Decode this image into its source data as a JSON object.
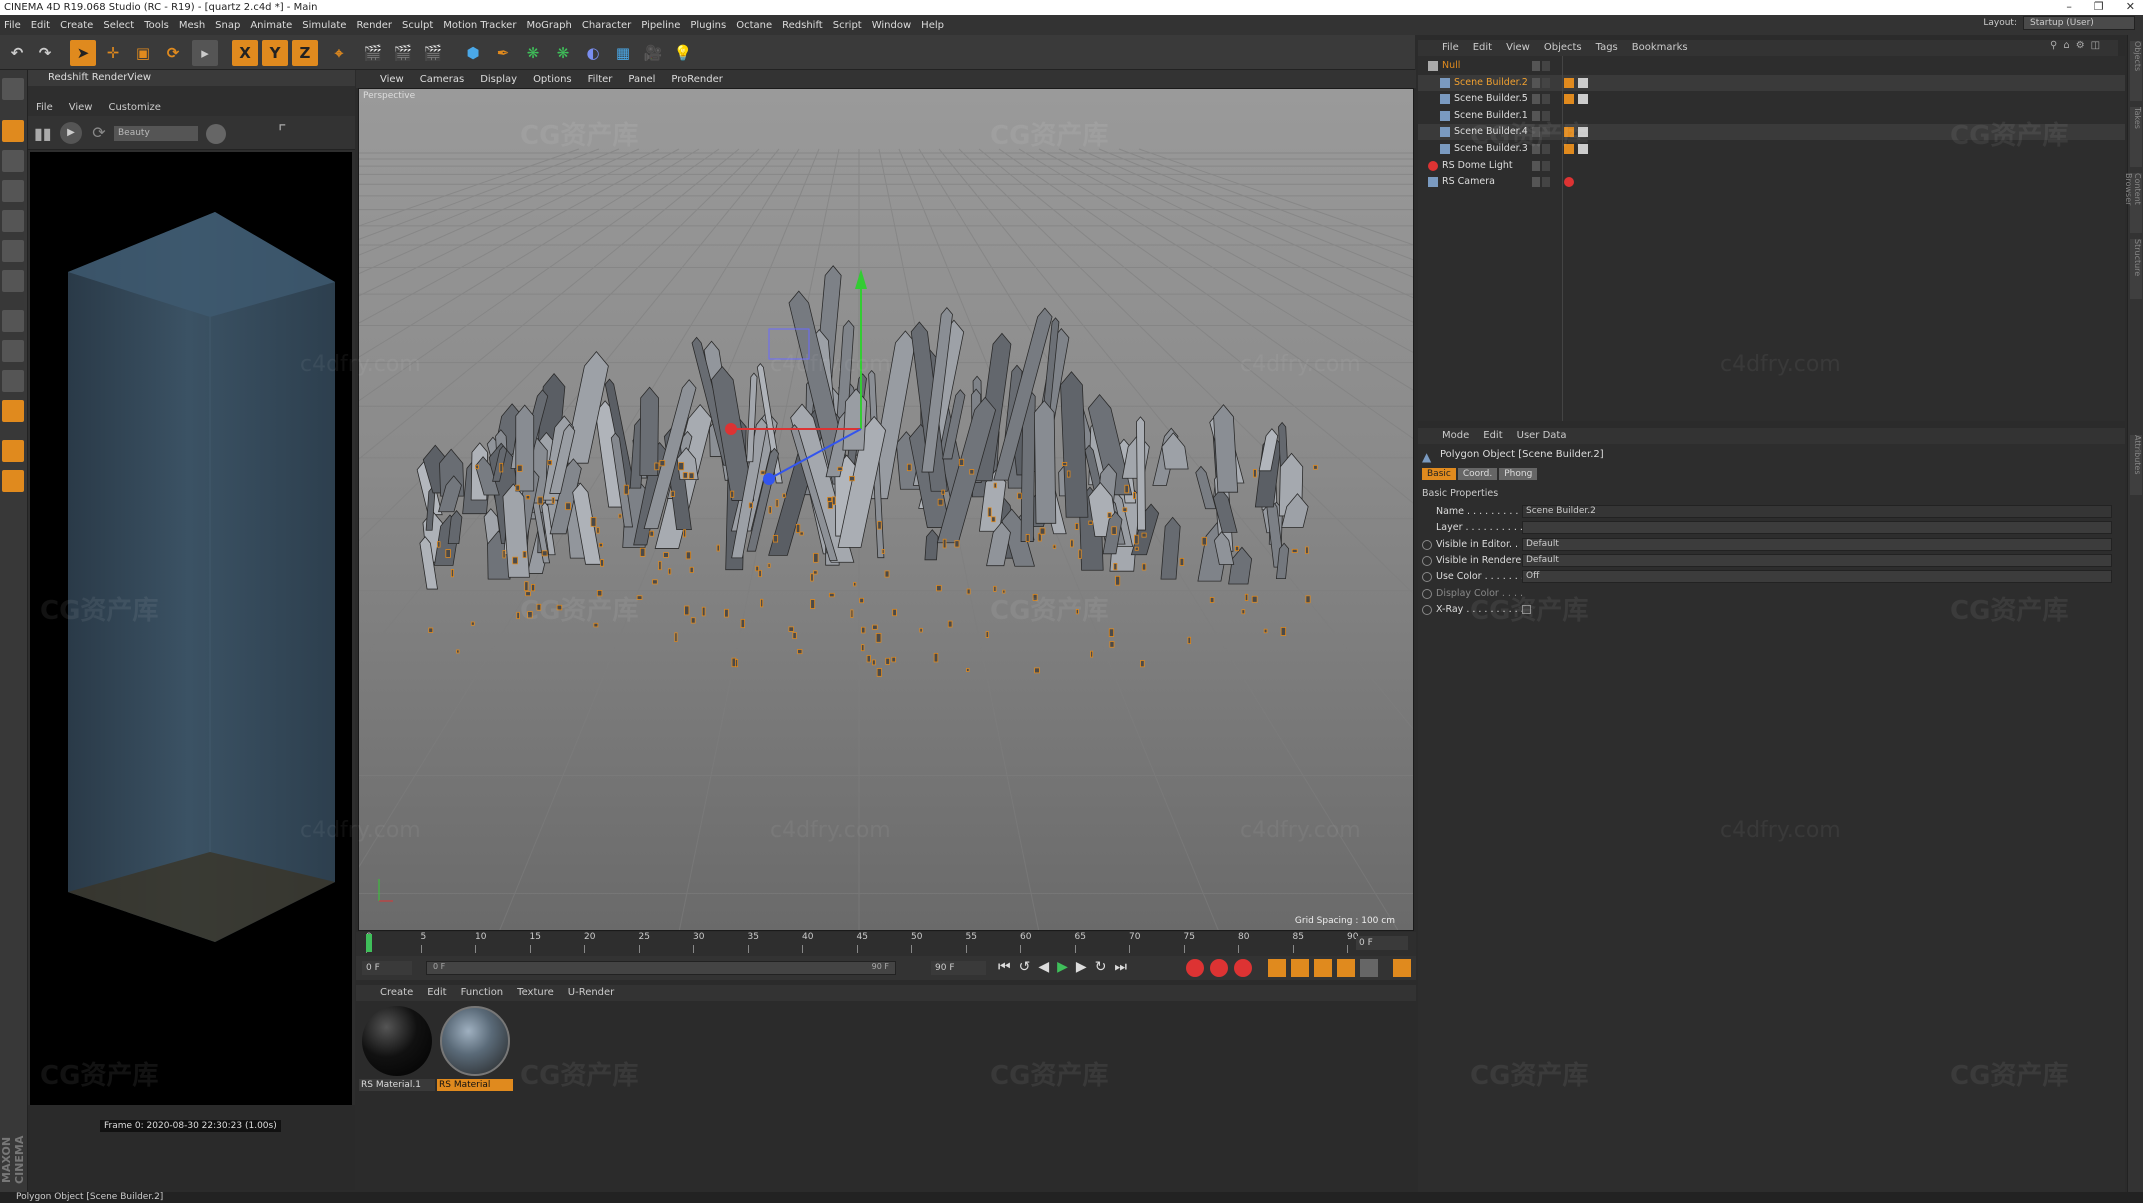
{
  "window": {
    "title": "CINEMA 4D R19.068 Studio (RC - R19) - [quartz 2.c4d *] - Main"
  },
  "menu": [
    "File",
    "Edit",
    "Create",
    "Select",
    "Tools",
    "Mesh",
    "Snap",
    "Animate",
    "Simulate",
    "Render",
    "Sculpt",
    "Motion Tracker",
    "MoGraph",
    "Character",
    "Pipeline",
    "Plugins",
    "Octane",
    "Redshift",
    "Script",
    "Window",
    "Help"
  ],
  "layout": {
    "label": "Layout:",
    "value": "Startup (User)"
  },
  "toolbar": {
    "axis_x": "X",
    "axis_y": "Y",
    "axis_z": "Z"
  },
  "renderview": {
    "title": "Redshift RenderView",
    "menu": [
      "File",
      "View",
      "Customize"
    ],
    "aov": "Beauty",
    "frame_info": "Frame 0:  2020-08-30  22:30:23  (1.00s)"
  },
  "viewport": {
    "menu": [
      "View",
      "Cameras",
      "Display",
      "Options",
      "Filter",
      "Panel",
      "ProRender"
    ],
    "label": "Perspective",
    "grid_spacing": "Grid Spacing : 100 cm"
  },
  "timeline": {
    "ticks": [
      "0",
      "5",
      "10",
      "15",
      "20",
      "25",
      "30",
      "35",
      "40",
      "45",
      "50",
      "55",
      "60",
      "65",
      "70",
      "75",
      "80",
      "85",
      "90"
    ],
    "current": "0 F",
    "start": "0 F",
    "range_start": "0 F",
    "range_end": "90 F",
    "end": "90 F"
  },
  "materials": {
    "menu": [
      "Create",
      "Edit",
      "Function",
      "Texture",
      "U-Render"
    ],
    "items": [
      {
        "name": "RS Material.1",
        "selected": false
      },
      {
        "name": "RS Material",
        "selected": true
      }
    ]
  },
  "objects": {
    "menu": [
      "File",
      "Edit",
      "View",
      "Objects",
      "Tags",
      "Bookmarks"
    ],
    "rows": [
      {
        "name": "Null",
        "color": "#e08a1e",
        "indent": 0
      },
      {
        "name": "Scene Builder.2",
        "color": "#f0a030",
        "indent": 1
      },
      {
        "name": "Scene Builder.5",
        "color": "#dddddd",
        "indent": 1
      },
      {
        "name": "Scene Builder.1",
        "color": "#dddddd",
        "indent": 1
      },
      {
        "name": "Scene Builder.4",
        "color": "#dddddd",
        "indent": 1
      },
      {
        "name": "Scene Builder.3",
        "color": "#dddddd",
        "indent": 1
      },
      {
        "name": "RS Dome Light",
        "color": "#dddddd",
        "indent": 0
      },
      {
        "name": "RS Camera",
        "color": "#dddddd",
        "indent": 0
      }
    ]
  },
  "attributes": {
    "menu": [
      "Mode",
      "Edit",
      "User Data"
    ],
    "object_title": "Polygon Object [Scene Builder.2]",
    "tabs": [
      "Basic",
      "Coord.",
      "Phong"
    ],
    "section": "Basic Properties",
    "fields": [
      {
        "label": "Name . . . . . . . . . .",
        "value": "Scene Builder.2"
      },
      {
        "label": "Layer . . . . . . . . . .",
        "value": ""
      },
      {
        "label": "Visible in Editor. . .",
        "value": "Default"
      },
      {
        "label": "Visible in Renderer",
        "value": "Default"
      },
      {
        "label": "Use Color . . . . . . .",
        "value": "Off"
      },
      {
        "label": "Display Color . . . .",
        "value": ""
      },
      {
        "label": "X-Ray . . . . . . . . . .",
        "value": ""
      }
    ]
  },
  "side_tabs": [
    "Objects",
    "Takes",
    "Content Browser",
    "Structure",
    "Attributes"
  ],
  "brand_vertical": "MAXON CINEMA 4D",
  "status": "Polygon Object [Scene Builder.2]",
  "watermarks": {
    "cg": "CG资产库",
    "site": "c4dfry.com"
  }
}
